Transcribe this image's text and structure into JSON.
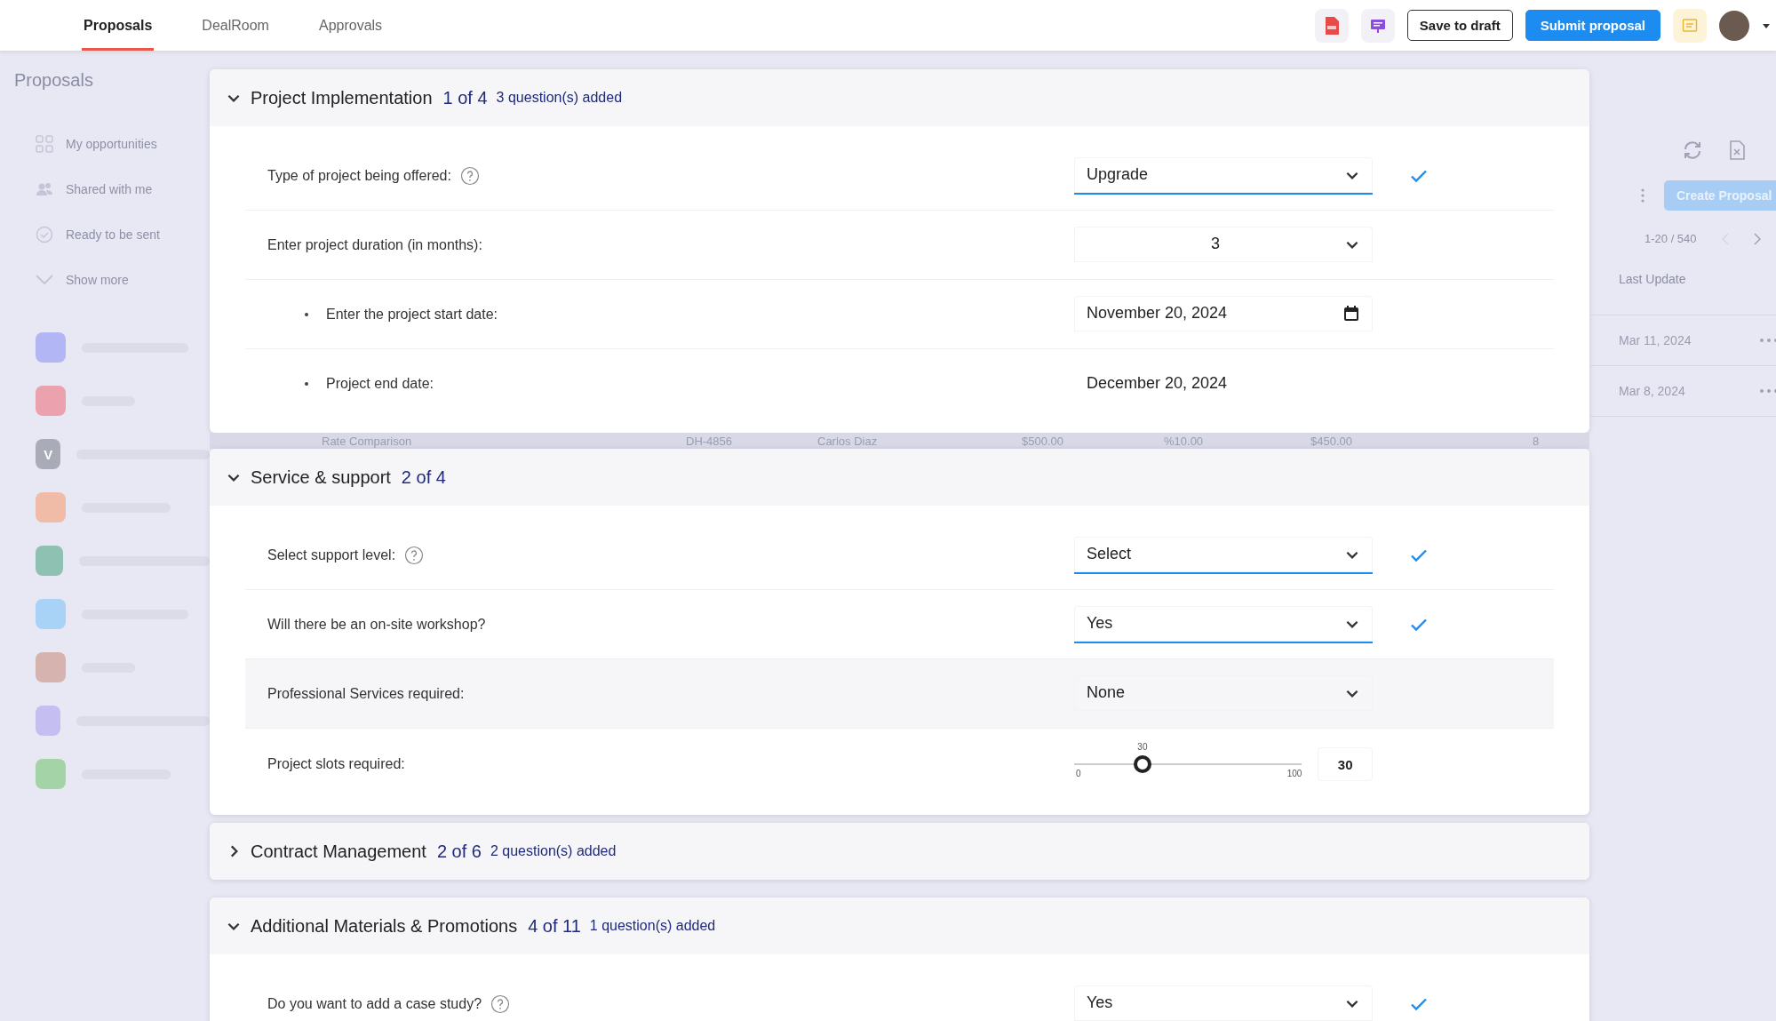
{
  "top_bar": {
    "tabs": [
      {
        "label": "Proposals",
        "selected": true
      },
      {
        "label": "DealRoom",
        "selected": false
      },
      {
        "label": "Approvals",
        "selected": false
      }
    ],
    "buttons": [
      {
        "label": "Save to draft",
        "kind": "outline"
      },
      {
        "label": "Submit proposal",
        "kind": "primary"
      }
    ]
  },
  "sidebar": {
    "title": "Proposals",
    "items": [
      {
        "label": "My opportunities",
        "kind": "grid"
      },
      {
        "label": "Shared with me",
        "kind": "people"
      },
      {
        "label": "Ready to be sent",
        "kind": "check"
      },
      {
        "label": "Show more",
        "kind": "more"
      }
    ],
    "apps": [
      {
        "color": "#b3b6f5"
      },
      {
        "color": "#eba2ae"
      },
      {
        "color": "#a9abb8",
        "letter": "V"
      },
      {
        "color": "#f0bca8"
      },
      {
        "color": "#8fc1b2"
      },
      {
        "color": "#a9d2f7"
      },
      {
        "color": "#d6b3ae"
      },
      {
        "color": "#c4bff0"
      },
      {
        "color": "#a3d3a6"
      }
    ]
  },
  "background_list": {
    "pagination": "1-20 / 540",
    "create_button": "Create Proposal",
    "column": "Last Update",
    "dates": [
      "Mar 11, 2024",
      "Mar 8, 2024"
    ],
    "row": {
      "title": "Rate Comparison",
      "id": "DH-4856",
      "owner": "Carlos Diaz",
      "amount": "$500.00",
      "discount": "%10.00",
      "total": "$450.00",
      "count": "8"
    }
  },
  "sections": [
    {
      "title": "Project Implementation",
      "count": "1 of 4",
      "added": "3 question(s) added",
      "expanded": true,
      "rows": [
        {
          "kind": "select",
          "label": "Type of project being offered:",
          "help": true,
          "value": "Upgrade",
          "answered": true
        },
        {
          "kind": "number",
          "label": "Enter project duration (in months):",
          "value": "3",
          "answered": false
        },
        {
          "kind": "date",
          "label": "Enter the project start date:",
          "bullet": true,
          "value": "November 20, 2024",
          "answered": false
        },
        {
          "kind": "static",
          "label": "Project end date:",
          "bullet": true,
          "value": "December 20, 2024"
        }
      ]
    },
    {
      "title": "Service & support",
      "count": "2 of 4",
      "expanded": true,
      "rows": [
        {
          "kind": "select",
          "label": "Select support level:",
          "help": true,
          "value": "Select",
          "answered": true
        },
        {
          "kind": "select",
          "label": "Will there be an on-site workshop?",
          "value": "Yes",
          "answered": true
        },
        {
          "kind": "select",
          "label": "Professional Services required:",
          "value": "None",
          "answered": false,
          "highlighted": true
        },
        {
          "kind": "slider",
          "label": "Project slots required:",
          "min": "0",
          "max": "100",
          "thumb_label": "30",
          "level": 0.3,
          "reading": "30"
        }
      ]
    },
    {
      "title": "Contract Management",
      "count": "2 of 6",
      "added": "2 question(s) added",
      "expanded": false
    },
    {
      "title": "Additional Materials & Promotions",
      "count": "4 of 11",
      "added": "1 question(s) added",
      "expanded": true,
      "rows": [
        {
          "kind": "select",
          "label": "Do you want to add a case study?",
          "help": true,
          "value": "Yes",
          "answered": true
        }
      ]
    }
  ]
}
